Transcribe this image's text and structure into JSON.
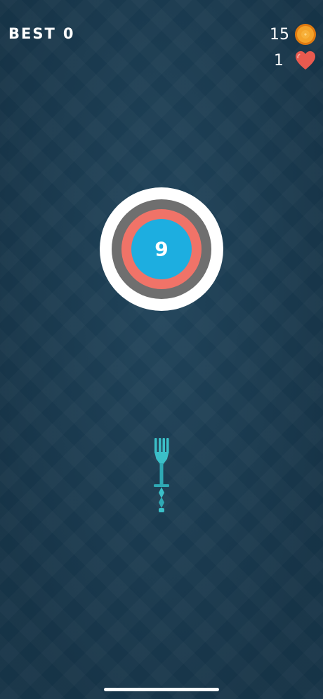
{
  "hud": {
    "best_label": "BEST",
    "best_value": "0",
    "coins": "15",
    "lives": "1",
    "coin_icon": "orange-icon",
    "lives_icon": "heart-icon"
  },
  "target": {
    "hits_remaining": "9",
    "colors": {
      "outer": "#ffffff",
      "ring1": "#6f6f6f",
      "ring2": "#f07368",
      "center": "#1daee0"
    }
  },
  "projectile": {
    "type": "fork",
    "color": "#3bbfc8"
  },
  "colors": {
    "background": "#1d3f55",
    "accent": "#3bbfc8"
  }
}
